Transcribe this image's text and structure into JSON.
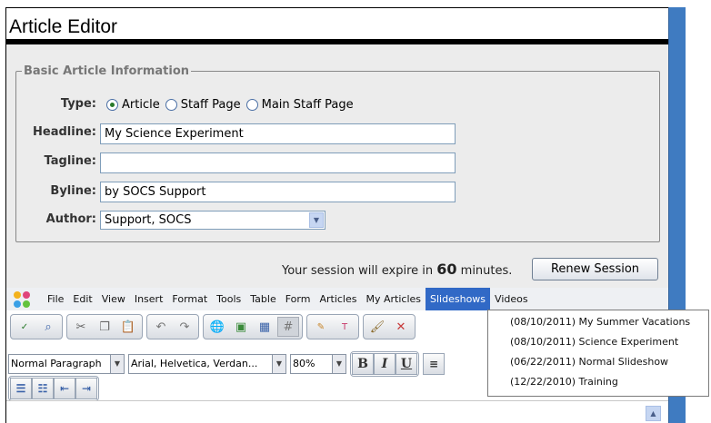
{
  "page": {
    "title": "Article Editor"
  },
  "form": {
    "legend": "Basic Article Information",
    "type_label": "Type:",
    "type_options": [
      "Article",
      "Staff Page",
      "Main Staff Page"
    ],
    "type_selected": "Article",
    "headline_label": "Headline:",
    "headline_value": "My Science Experiment",
    "tagline_label": "Tagline:",
    "tagline_value": "",
    "byline_label": "Byline:",
    "byline_value": "by SOCS Support",
    "author_label": "Author:",
    "author_value": "Support, SOCS"
  },
  "session": {
    "prefix": "Your session will expire in",
    "minutes": "60",
    "suffix": "minutes.",
    "renew_label": "Renew Session"
  },
  "menubar": {
    "items": [
      "File",
      "Edit",
      "View",
      "Insert",
      "Format",
      "Tools",
      "Table",
      "Form",
      "Articles",
      "My Articles",
      "Slideshows",
      "Videos"
    ],
    "active": "Slideshows"
  },
  "slideshows_dropdown": {
    "items": [
      "(08/10/2011) My Summer Vacations",
      "(08/10/2011) Science Experiment",
      "(06/22/2011) Normal Slideshow",
      "(12/22/2010) Training"
    ]
  },
  "formatting": {
    "paragraph_style": "Normal Paragraph",
    "font_family": "Arial, Helvetica, Verdan...",
    "font_size": "80%",
    "bold_label": "B",
    "italic_label": "I",
    "underline_label": "U"
  },
  "colors": {
    "accent": "#3169c6",
    "side_bar": "#3f7bc1",
    "panel_bg": "#ececec"
  }
}
